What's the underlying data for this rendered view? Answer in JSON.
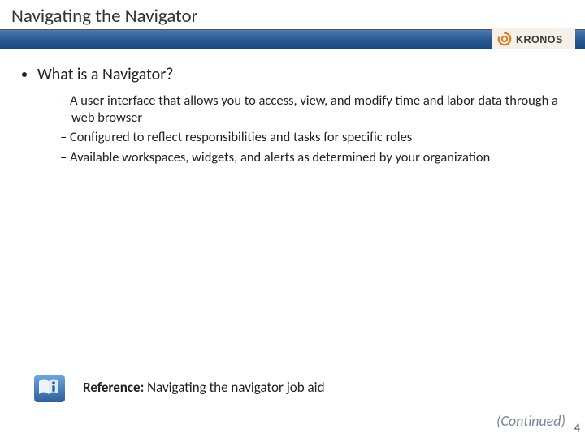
{
  "title": "Navigating the Navigator",
  "brand": "KRONOS",
  "bullets": {
    "l1": "What is a Navigator?",
    "l2": [
      "A user interface that allows you to access, view, and modify time and labor data through a web browser",
      "Configured to reflect responsibilities and tasks for specific roles",
      "Available workspaces, widgets, and alerts as determined by your organization"
    ]
  },
  "reference": {
    "label": "Reference:",
    "link_text": "Navigating the navigator",
    "suffix": " job aid"
  },
  "continued": "(Continued)",
  "page_number": "4",
  "colors": {
    "bar_top": "#4a7ab0",
    "bar_bottom": "#1d4780",
    "logo_accent": "#d97b1f",
    "icon_blue": "#2f5f9a"
  }
}
